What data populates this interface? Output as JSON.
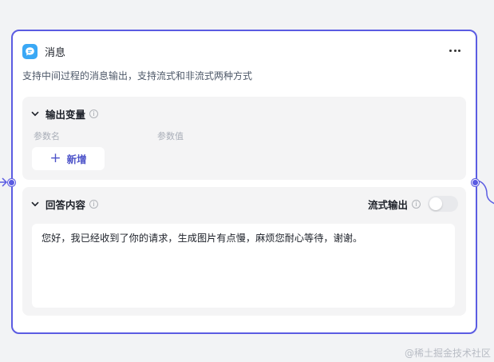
{
  "node": {
    "title": "消息",
    "description": "支持中间过程的消息输出，支持流式和非流式两种方式",
    "more_label": "..."
  },
  "output_section": {
    "title": "输出变量",
    "col_name": "参数名",
    "col_value": "参数值",
    "add_label": "新增"
  },
  "answer_section": {
    "title": "回答内容",
    "stream_label": "流式输出",
    "stream_enabled": false,
    "content": "您好，我已经收到了你的请求，生成图片有点慢，麻烦您耐心等待，谢谢。"
  },
  "icons": {
    "node": "message-icon",
    "info": "info-icon",
    "chevron": "chevron-down-icon",
    "add": "plus-icon",
    "more": "more-icon"
  },
  "colors": {
    "accent": "#5b5ce2",
    "icon_bg": "#3aa8f5",
    "add_text": "#4d53c9"
  },
  "watermark": "@稀土掘金技术社区"
}
